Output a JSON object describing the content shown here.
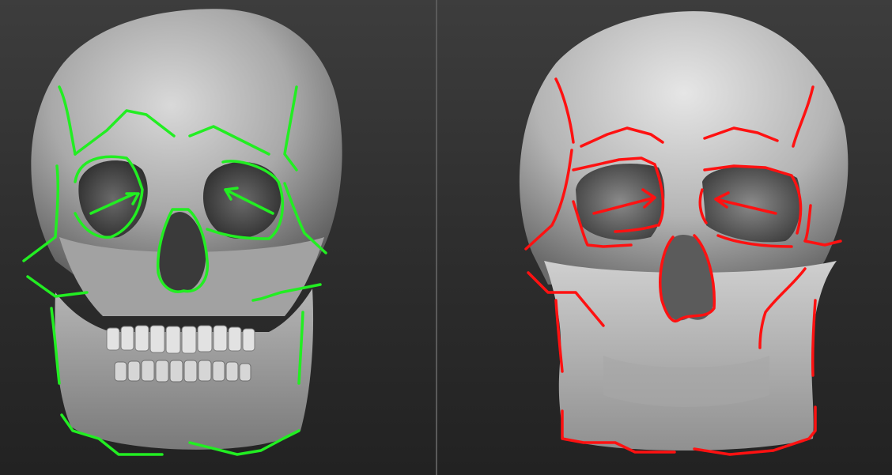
{
  "viewer": {
    "panels": [
      {
        "subject": "skull-reference",
        "guide_color": "#22ee22"
      },
      {
        "subject": "skull-sculpt",
        "guide_color": "#ff1111"
      }
    ],
    "background": "#2e2e2e",
    "divider_color": "#5a5a5a"
  }
}
